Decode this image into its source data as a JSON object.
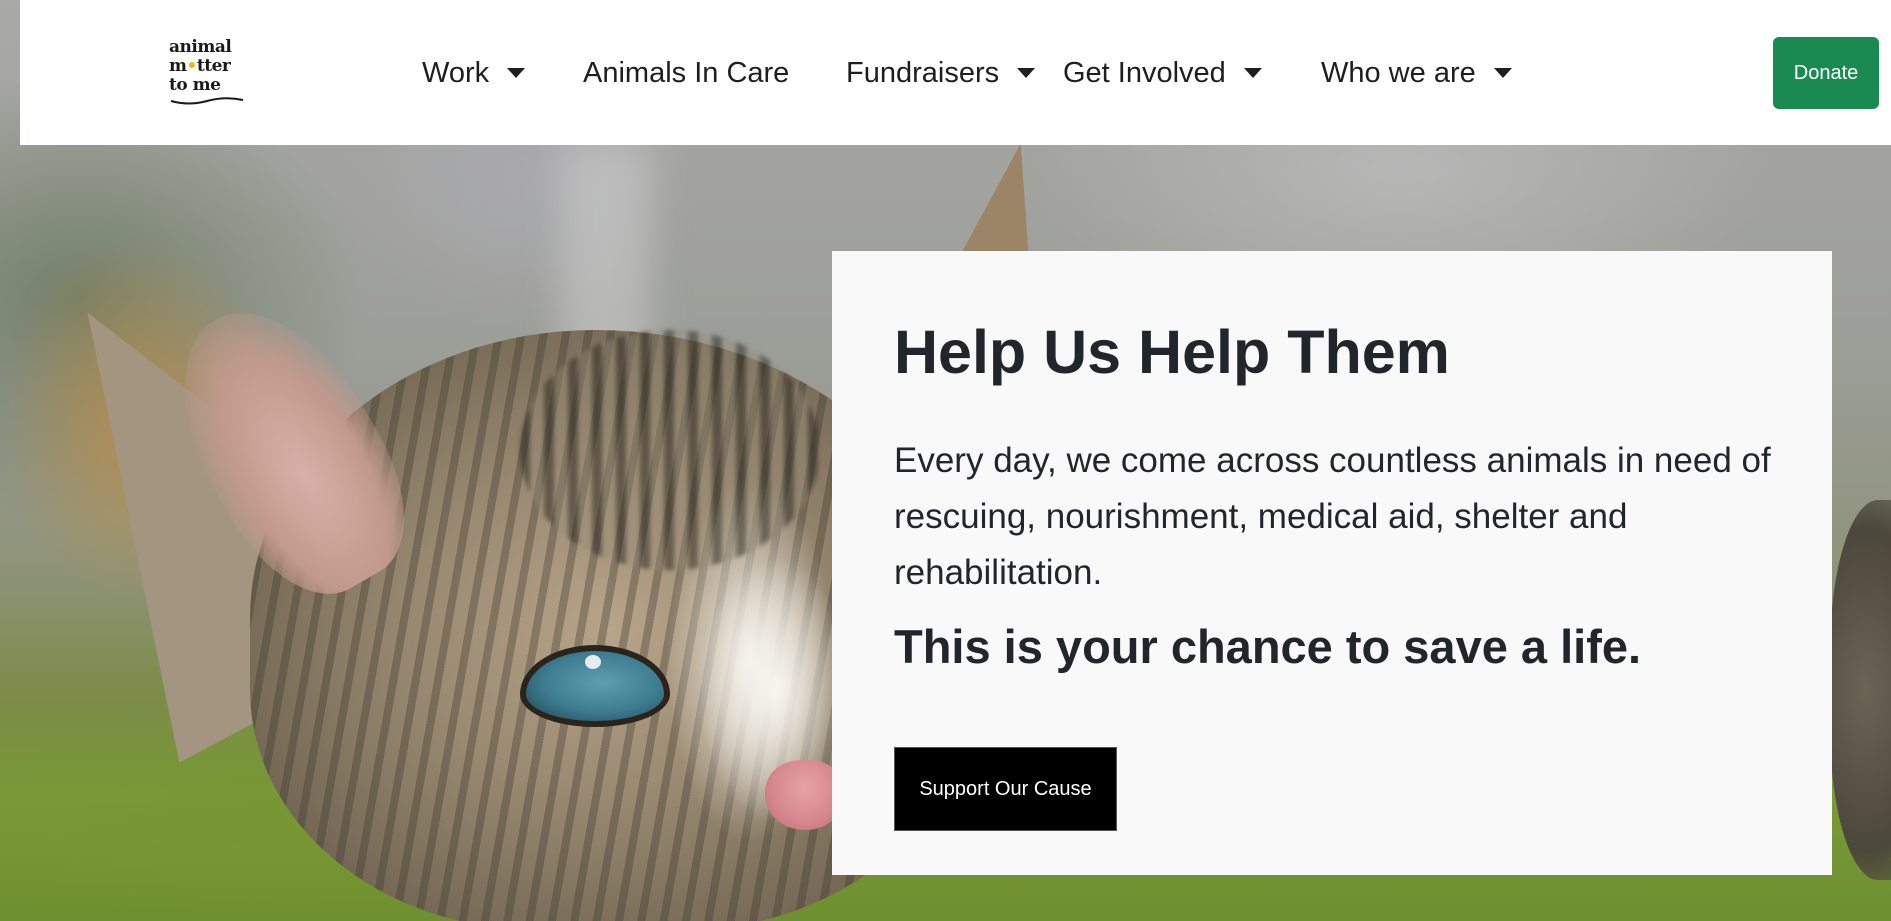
{
  "header": {
    "logo": {
      "line1": "animal",
      "line2_start": "m",
      "line2_paw": "•",
      "line2_end": "tter",
      "line3": "to me"
    },
    "nav": [
      {
        "label": "Work",
        "has_dropdown": true
      },
      {
        "label": "Animals In Care",
        "has_dropdown": false
      },
      {
        "label": "Fundraisers",
        "has_dropdown": true
      },
      {
        "label": "Get Involved",
        "has_dropdown": true
      },
      {
        "label": "Who we are",
        "has_dropdown": true
      }
    ],
    "donate_label": "Donate"
  },
  "hero": {
    "title": "Help Us Help Them",
    "body": "Every day, we come across countless animals in need of rescuing, nourishment, medical aid, shelter and rehabilitation.",
    "tagline": "This is your chance to save a life.",
    "cta_label": "Support Our Cause"
  },
  "colors": {
    "donate_green": "#1a8a52",
    "cta_black": "#000000",
    "card_background": "#f9f9f9",
    "text_dark": "#22252b",
    "logo_paw_yellow": "#f2b516"
  },
  "icons": {
    "dropdown": "caret-down-icon"
  }
}
